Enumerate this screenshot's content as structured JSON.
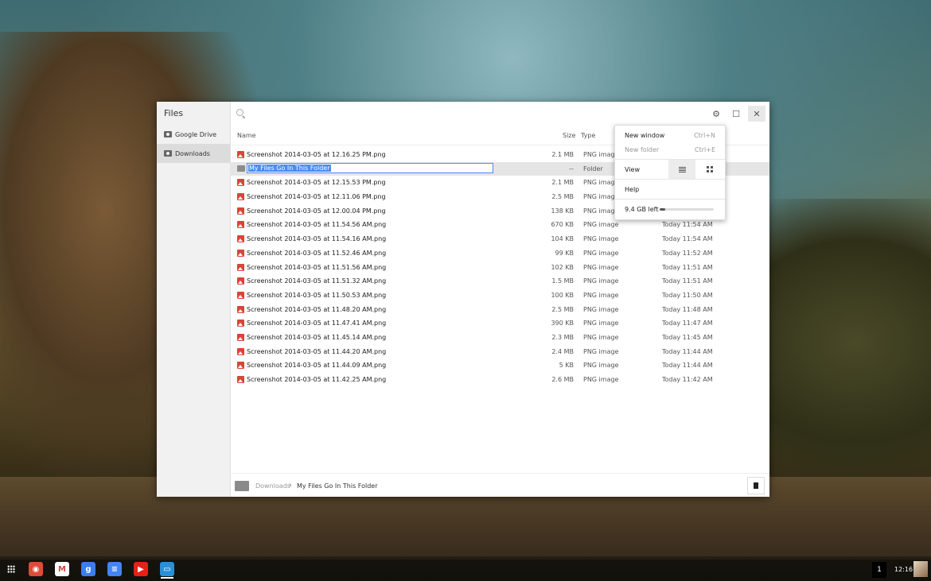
{
  "app": {
    "title": "Files"
  },
  "sidebar": {
    "items": [
      {
        "label": "Google Drive",
        "icon": "drive-icon"
      },
      {
        "label": "Downloads",
        "icon": "downloads-icon",
        "selected": true
      }
    ]
  },
  "search": {
    "placeholder": ""
  },
  "columns": {
    "name": "Name",
    "size": "Size",
    "type": "Type"
  },
  "files": [
    {
      "name": "Screenshot 2014-03-05 at 12.16.25 PM.png",
      "size": "2.1 MB",
      "type": "PNG image",
      "date": ""
    },
    {
      "name": "My Files Go In This Folder",
      "size": "--",
      "type": "Folder",
      "date": "",
      "renaming": true
    },
    {
      "name": "Screenshot 2014-03-05 at 12.15.53 PM.png",
      "size": "2.1 MB",
      "type": "PNG image",
      "date": ""
    },
    {
      "name": "Screenshot 2014-03-05 at 12.11.06 PM.png",
      "size": "2.5 MB",
      "type": "PNG image",
      "date": ""
    },
    {
      "name": "Screenshot 2014-03-05 at 12.00.04 PM.png",
      "size": "138 KB",
      "type": "PNG image",
      "date": ""
    },
    {
      "name": "Screenshot 2014-03-05 at 11.54.56 AM.png",
      "size": "670 KB",
      "type": "PNG image",
      "date": "Today 11:54 AM"
    },
    {
      "name": "Screenshot 2014-03-05 at 11.54.16 AM.png",
      "size": "104 KB",
      "type": "PNG image",
      "date": "Today 11:54 AM"
    },
    {
      "name": "Screenshot 2014-03-05 at 11.52.46 AM.png",
      "size": "99 KB",
      "type": "PNG image",
      "date": "Today 11:52 AM"
    },
    {
      "name": "Screenshot 2014-03-05 at 11.51.56 AM.png",
      "size": "102 KB",
      "type": "PNG image",
      "date": "Today 11:51 AM"
    },
    {
      "name": "Screenshot 2014-03-05 at 11.51.32 AM.png",
      "size": "1.5 MB",
      "type": "PNG image",
      "date": "Today 11:51 AM"
    },
    {
      "name": "Screenshot 2014-03-05 at 11.50.53 AM.png",
      "size": "100 KB",
      "type": "PNG image",
      "date": "Today 11:50 AM"
    },
    {
      "name": "Screenshot 2014-03-05 at 11.48.20 AM.png",
      "size": "2.5 MB",
      "type": "PNG image",
      "date": "Today 11:48 AM"
    },
    {
      "name": "Screenshot 2014-03-05 at 11.47.41 AM.png",
      "size": "390 KB",
      "type": "PNG image",
      "date": "Today 11:47 AM"
    },
    {
      "name": "Screenshot 2014-03-05 at 11.45.14 AM.png",
      "size": "2.3 MB",
      "type": "PNG image",
      "date": "Today 11:45 AM"
    },
    {
      "name": "Screenshot 2014-03-05 at 11.44.20 AM.png",
      "size": "2.4 MB",
      "type": "PNG image",
      "date": "Today 11:44 AM"
    },
    {
      "name": "Screenshot 2014-03-05 at 11.44.09 AM.png",
      "size": "5 KB",
      "type": "PNG image",
      "date": "Today 11:44 AM"
    },
    {
      "name": "Screenshot 2014-03-05 at 11.42.25 AM.png",
      "size": "2.6 MB",
      "type": "PNG image",
      "date": "Today 11:42 AM"
    }
  ],
  "menu": {
    "new_window": "New window",
    "new_window_shortcut": "Ctrl+N",
    "new_folder": "New folder",
    "new_folder_shortcut": "Ctrl+E",
    "view": "View",
    "help": "Help",
    "space_left": "9.4 GB left",
    "space_used_fraction": 0.1
  },
  "breadcrumb": {
    "root": "Downloads",
    "sep": "›",
    "current": "My Files Go In This Folder"
  },
  "shelf": {
    "apps": [
      {
        "name": "chrome-icon",
        "color": "#dd4b39"
      },
      {
        "name": "gmail-icon",
        "color": "#ffffff"
      },
      {
        "name": "google-plus-icon",
        "color": "#3b7ded"
      },
      {
        "name": "docs-icon",
        "color": "#4285f4"
      },
      {
        "name": "youtube-icon",
        "color": "#e62117"
      },
      {
        "name": "files-icon",
        "color": "#2b8fd8"
      }
    ],
    "notification_count": "1",
    "clock": "12:16"
  }
}
